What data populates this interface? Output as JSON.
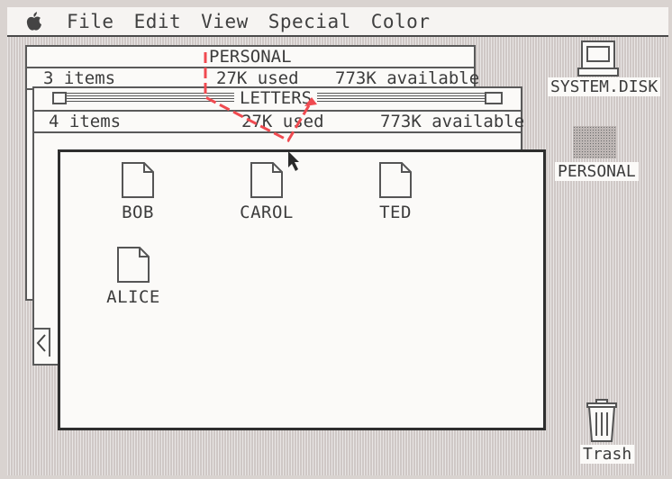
{
  "menubar": {
    "items": [
      "File",
      "Edit",
      "View",
      "Special",
      "Color"
    ]
  },
  "windows": {
    "personal": {
      "title": "PERSONAL",
      "items": "3 items",
      "used": "27K used",
      "available": "773K available"
    },
    "letters": {
      "title": "LETTERS",
      "items": "4 items",
      "used": "27K used",
      "available": "773K available",
      "files": [
        "BOB",
        "CAROL",
        "TED",
        "ALICE"
      ]
    }
  },
  "desktop": {
    "system_disk": "SYSTEM.DISK",
    "personal": "PERSONAL",
    "trash": "Trash"
  },
  "colors": {
    "annotation": "#f04a50",
    "desktop": "#cfc8c6",
    "window": "#fbfaf8"
  },
  "icons": [
    "apple-icon",
    "document-icon",
    "disk-icon",
    "folder-icon",
    "trash-icon",
    "pointer-icon"
  ]
}
